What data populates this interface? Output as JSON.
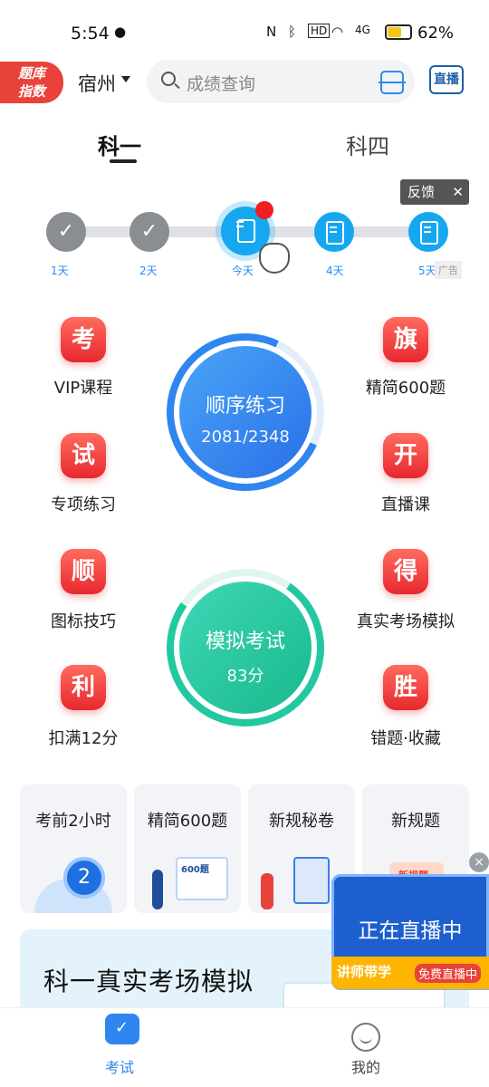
{
  "status_bar": {
    "time": "5:54",
    "signal": "4G",
    "battery_pct": "62%",
    "battery_level": 0.62
  },
  "header": {
    "logo_line1": "题库",
    "logo_line2": "指数",
    "city": "宿州",
    "search_placeholder": "成绩查询",
    "live_label": "直播"
  },
  "tabs": [
    {
      "label": "科一",
      "active": true
    },
    {
      "label": "科四",
      "active": false
    }
  ],
  "progress": {
    "feedback_label": "反馈",
    "ad_label": "广告",
    "days": [
      "1天",
      "2天",
      "今天",
      "4天",
      "5天"
    ]
  },
  "features": {
    "left": [
      {
        "badge": "考",
        "label": "VIP课程"
      },
      {
        "badge": "试",
        "label": "专项练习"
      },
      {
        "badge": "顺",
        "label": "图标技巧"
      },
      {
        "badge": "利",
        "label": "扣满12分"
      }
    ],
    "right": [
      {
        "badge": "旗",
        "label": "精简600题"
      },
      {
        "badge": "开",
        "label": "直播课"
      },
      {
        "badge": "得",
        "label": "真实考场模拟"
      },
      {
        "badge": "胜",
        "label": "错题·收藏"
      }
    ]
  },
  "practice_circle": {
    "title": "顺序练习",
    "progress_text": "2081/2348"
  },
  "exam_circle": {
    "title": "模拟考试",
    "score_text": "83分"
  },
  "cards": [
    {
      "title": "考前2小时",
      "art": "2"
    },
    {
      "title": "精简600题",
      "art": "600题"
    },
    {
      "title": "新规秘卷",
      "art": ""
    },
    {
      "title": "新规题",
      "art": "新规题库"
    }
  ],
  "banner": {
    "title": "科一真实考场模拟"
  },
  "live_popup": {
    "close_icon": "×",
    "title": "正在直播中",
    "strip_left": "讲师带学",
    "strip_right": "免费直播中"
  },
  "bottom_nav": [
    {
      "label": "考试",
      "active": true
    },
    {
      "label": "我的",
      "active": false
    }
  ]
}
